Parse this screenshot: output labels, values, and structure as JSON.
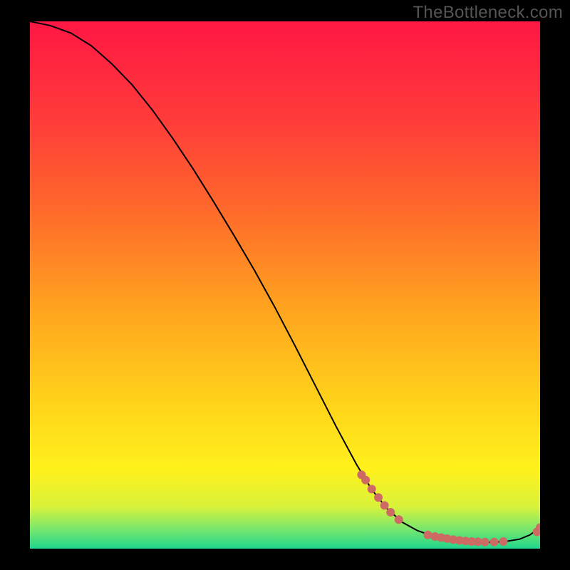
{
  "watermark": "TheBottleneck.com",
  "chart_data": {
    "type": "line",
    "title": "",
    "xlabel": "",
    "ylabel": "",
    "xlim": [
      0,
      100
    ],
    "ylim": [
      0,
      100
    ],
    "grid": false,
    "series": [
      {
        "name": "curve",
        "x": [
          0,
          4,
          8,
          12,
          16,
          20,
          24,
          28,
          32,
          36,
          40,
          44,
          48,
          52,
          56,
          60,
          64,
          67,
          70,
          73,
          76,
          79,
          82,
          85,
          88,
          91,
          93.5,
          96,
          98,
          100
        ],
        "y": [
          100,
          99.2,
          97.8,
          95.4,
          92.0,
          88.0,
          83.2,
          77.8,
          72.0,
          65.8,
          59.4,
          52.8,
          45.8,
          38.4,
          30.8,
          23.2,
          16.0,
          11.2,
          7.6,
          5.0,
          3.4,
          2.4,
          1.8,
          1.4,
          1.2,
          1.2,
          1.4,
          1.8,
          2.6,
          4.0
        ]
      }
    ],
    "markers": [
      {
        "x": 65.0,
        "y": 14.0
      },
      {
        "x": 65.8,
        "y": 13.0
      },
      {
        "x": 67.0,
        "y": 11.3
      },
      {
        "x": 68.3,
        "y": 9.7
      },
      {
        "x": 69.5,
        "y": 8.2
      },
      {
        "x": 70.7,
        "y": 6.9
      },
      {
        "x": 72.3,
        "y": 5.5
      },
      {
        "x": 78.0,
        "y": 2.6
      },
      {
        "x": 79.4,
        "y": 2.3
      },
      {
        "x": 80.6,
        "y": 2.1
      },
      {
        "x": 81.8,
        "y": 1.9
      },
      {
        "x": 83.0,
        "y": 1.7
      },
      {
        "x": 84.2,
        "y": 1.55
      },
      {
        "x": 85.4,
        "y": 1.45
      },
      {
        "x": 86.6,
        "y": 1.35
      },
      {
        "x": 87.8,
        "y": 1.3
      },
      {
        "x": 89.2,
        "y": 1.25
      },
      {
        "x": 91.0,
        "y": 1.25
      },
      {
        "x": 92.8,
        "y": 1.35
      },
      {
        "x": 99.4,
        "y": 3.2
      },
      {
        "x": 100.0,
        "y": 4.0
      }
    ],
    "gradient_stops": [
      {
        "offset": 0,
        "color": "#ff1744"
      },
      {
        "offset": 18,
        "color": "#ff3a3a"
      },
      {
        "offset": 36,
        "color": "#ff6a2b"
      },
      {
        "offset": 54,
        "color": "#ffa21f"
      },
      {
        "offset": 72,
        "color": "#ffd21a"
      },
      {
        "offset": 85,
        "color": "#fff11c"
      },
      {
        "offset": 92,
        "color": "#d9f23a"
      },
      {
        "offset": 96,
        "color": "#7fe86a"
      },
      {
        "offset": 100,
        "color": "#1fd68e"
      }
    ],
    "marker_color": "#cc6a63",
    "line_color": "#000000"
  }
}
